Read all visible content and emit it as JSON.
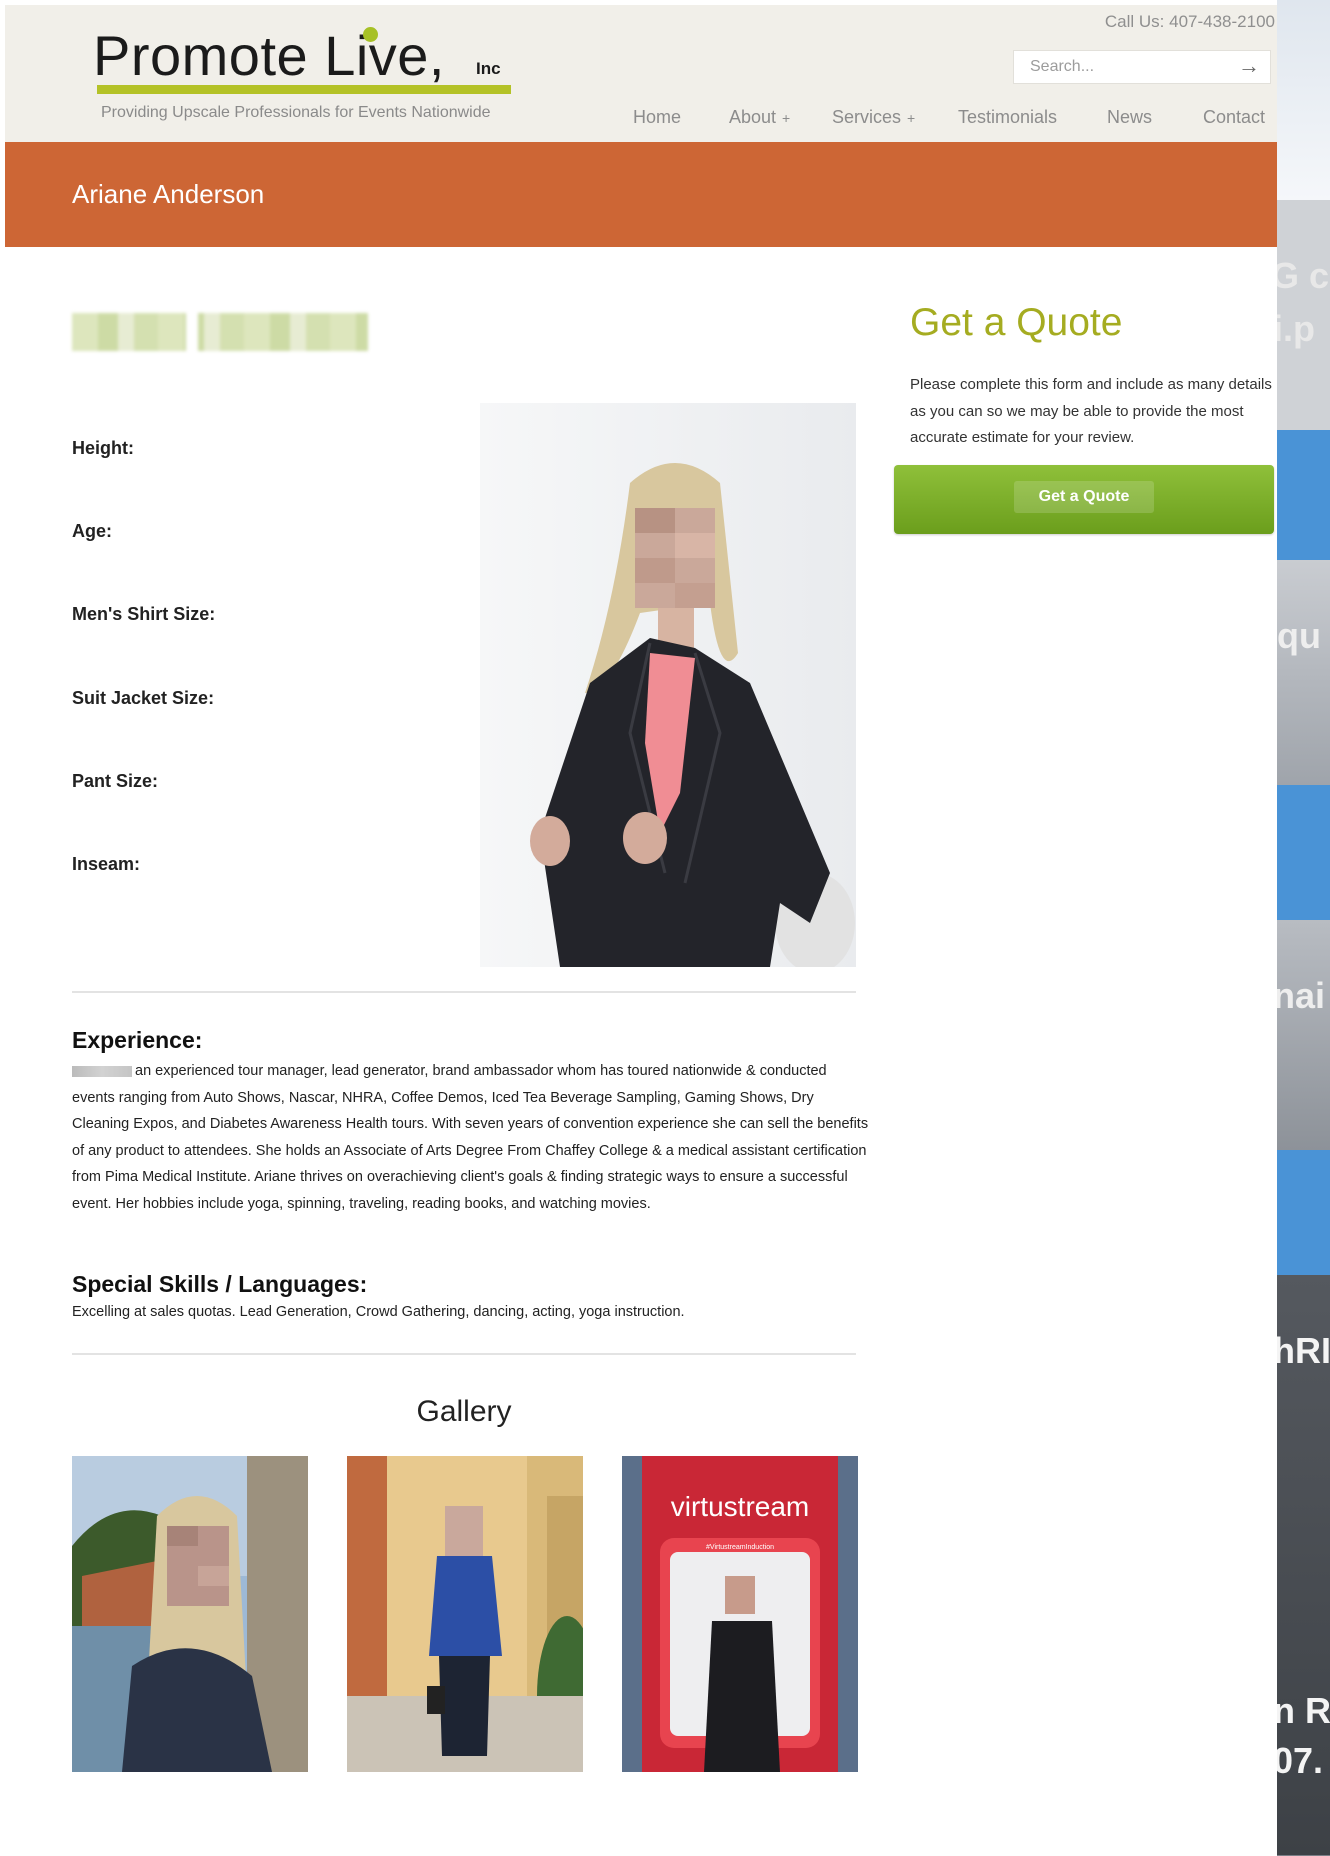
{
  "header": {
    "logo_word": "Promote Live,",
    "logo_inc": "Inc",
    "tagline": "Providing Upscale Professionals for Events Nationwide",
    "call_us": "Call Us: 407-438-2100",
    "search_placeholder": "Search..."
  },
  "nav": [
    {
      "label": "Home"
    },
    {
      "label": "About",
      "plus": "+"
    },
    {
      "label": "Services",
      "plus": "+"
    },
    {
      "label": "Testimonials"
    },
    {
      "label": "News"
    },
    {
      "label": "Contact"
    }
  ],
  "banner": {
    "title": "Ariane Anderson"
  },
  "profile": {
    "stats": [
      "Height:",
      "Age:",
      "Men's Shirt Size:",
      "Suit Jacket Size:",
      "Pant Size:",
      "Inseam:"
    ],
    "experience_heading": "Experience:",
    "experience_text": "an experienced tour manager, lead generator, brand ambassador whom has toured nationwide & conducted events ranging from Auto Shows, Nascar, NHRA, Coffee Demos, Iced Tea Beverage Sampling, Gaming Shows, Dry Cleaning Expos, and Diabetes Awareness Health tours. With seven years of convention experience she can sell the benefits of any product to attendees. She holds an Associate of Arts Degree From Chaffey College & a medical assistant certification from Pima Medical Institute. Ariane thrives on overachieving client's goals & finding strategic ways to ensure a successful event. Her hobbies include yoga, spinning, traveling, reading books, and watching movies.",
    "skills_heading": "Special Skills / Languages:",
    "skills_text": "Excelling at sales quotas. Lead Generation, Crowd Gathering, dancing, acting, yoga instruction."
  },
  "gallery": {
    "title": "Gallery",
    "photo3_sign": "virtustream",
    "photo3_sub": "#VirtustreamInduction"
  },
  "sidebar": {
    "quote_title": "Get a Quote",
    "quote_text": "Please complete this form and include as many details as you can so we may be able to provide the most accurate estimate for your review.",
    "quote_button": "Get a Quote"
  },
  "background_window": {
    "fragments": [
      "G c",
      "i.p",
      "iqu",
      "nai",
      "hRI",
      "n R",
      "07."
    ]
  },
  "colors": {
    "banner": "#cd6635",
    "logo_bar": "#b4c227",
    "quote_title": "#a5ac21",
    "quote_button": "#7aad28"
  }
}
